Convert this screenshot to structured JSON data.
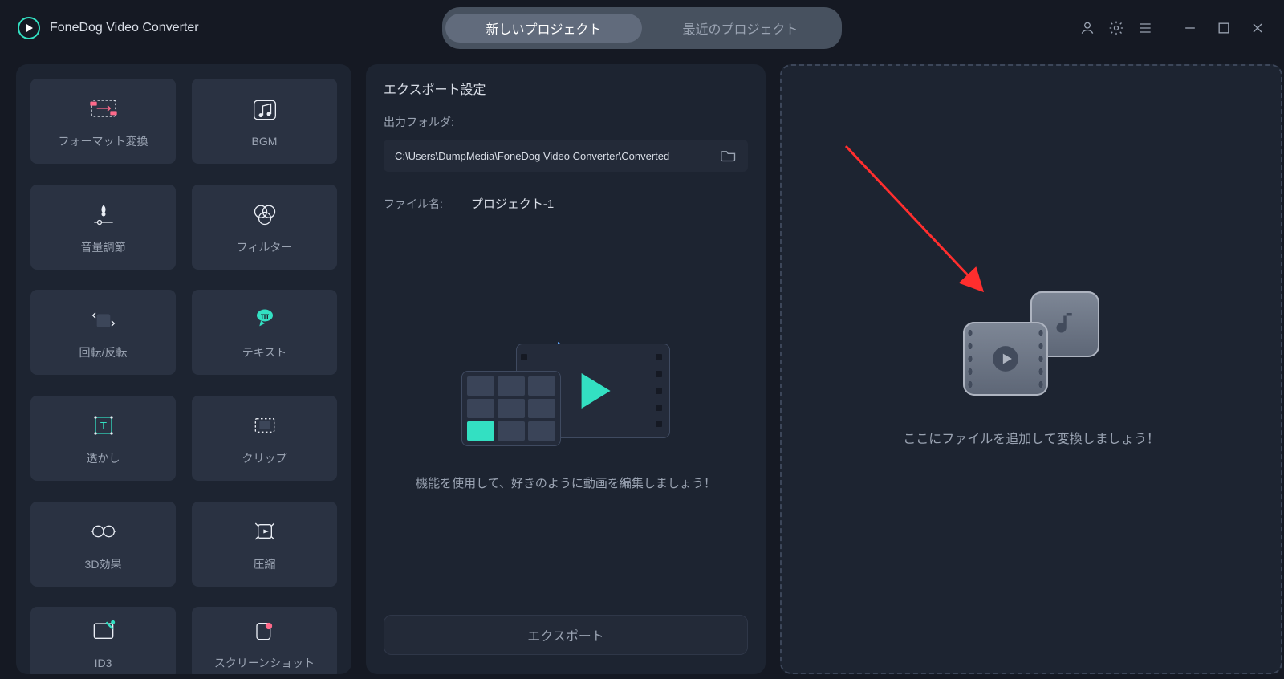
{
  "titlebar": {
    "app_name": "FoneDog Video Converter",
    "tabs": {
      "new_project": "新しいプロジェクト",
      "recent_project": "最近のプロジェクト"
    }
  },
  "tools": [
    {
      "id": "format-convert",
      "label": "フォーマット変換"
    },
    {
      "id": "bgm",
      "label": "BGM"
    },
    {
      "id": "volume",
      "label": "音量調節"
    },
    {
      "id": "filter",
      "label": "フィルター"
    },
    {
      "id": "rotate-flip",
      "label": "回転/反転"
    },
    {
      "id": "text",
      "label": "テキスト"
    },
    {
      "id": "watermark",
      "label": "透かし"
    },
    {
      "id": "clip",
      "label": "クリップ"
    },
    {
      "id": "3d-effect",
      "label": "3D効果"
    },
    {
      "id": "compress",
      "label": "圧縮"
    },
    {
      "id": "id3",
      "label": "ID3"
    },
    {
      "id": "screenshot",
      "label": "スクリーンショット"
    }
  ],
  "export": {
    "title": "エクスポート設定",
    "folder_label": "出力フォルダ:",
    "folder_value": "C:\\Users\\DumpMedia\\FoneDog Video Converter\\Converted",
    "filename_label": "ファイル名:",
    "filename_value": "プロジェクト-1",
    "canvas_hint": "機能を使用して、好きのように動画を編集しましょう！",
    "button": "エクスポート"
  },
  "dropzone": {
    "hint": "ここにファイルを追加して変換しましょう！"
  }
}
